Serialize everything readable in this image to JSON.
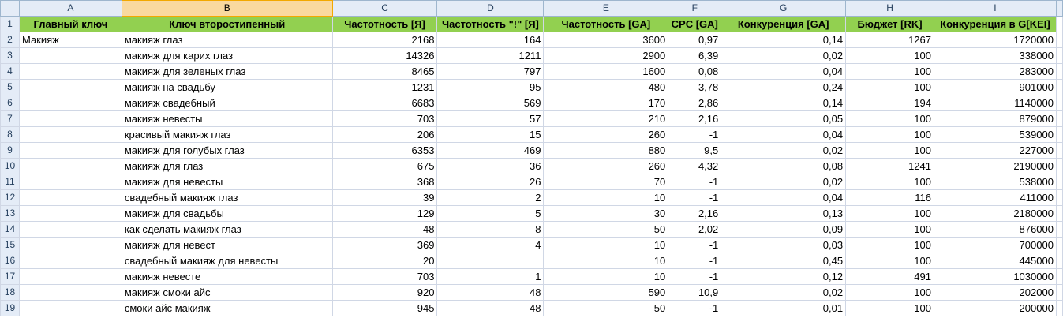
{
  "columns": [
    "A",
    "B",
    "C",
    "D",
    "E",
    "F",
    "G",
    "H",
    "I"
  ],
  "headers": [
    "Главный ключ",
    "Ключ второстипенный",
    "Частотность [Я]",
    "Частотность \"!\" [Я]",
    "Частотность [GA]",
    "CPC [GA]",
    "Конкуренция [GA]",
    "Бюджет [RK]",
    "Конкуренция в G[KEI]"
  ],
  "rows": [
    {
      "n": "2",
      "a": "Макияж",
      "b": "макияж глаз",
      "c": "2168",
      "d": "164",
      "e": "3600",
      "f": "0,97",
      "g": "0,14",
      "h": "1267",
      "i": "1720000"
    },
    {
      "n": "3",
      "a": "",
      "b": "макияж для карих глаз",
      "c": "14326",
      "d": "1211",
      "e": "2900",
      "f": "6,39",
      "g": "0,02",
      "h": "100",
      "i": "338000"
    },
    {
      "n": "4",
      "a": "",
      "b": "макияж для зеленых глаз",
      "c": "8465",
      "d": "797",
      "e": "1600",
      "f": "0,08",
      "g": "0,04",
      "h": "100",
      "i": "283000"
    },
    {
      "n": "5",
      "a": "",
      "b": "макияж на свадьбу",
      "c": "1231",
      "d": "95",
      "e": "480",
      "f": "3,78",
      "g": "0,24",
      "h": "100",
      "i": "901000"
    },
    {
      "n": "6",
      "a": "",
      "b": "макияж свадебный",
      "c": "6683",
      "d": "569",
      "e": "170",
      "f": "2,86",
      "g": "0,14",
      "h": "194",
      "i": "1140000"
    },
    {
      "n": "7",
      "a": "",
      "b": "макияж невесты",
      "c": "703",
      "d": "57",
      "e": "210",
      "f": "2,16",
      "g": "0,05",
      "h": "100",
      "i": "879000"
    },
    {
      "n": "8",
      "a": "",
      "b": "красивый макияж глаз",
      "c": "206",
      "d": "15",
      "e": "260",
      "f": "-1",
      "g": "0,04",
      "h": "100",
      "i": "539000"
    },
    {
      "n": "9",
      "a": "",
      "b": "макияж для голубых глаз",
      "c": "6353",
      "d": "469",
      "e": "880",
      "f": "9,5",
      "g": "0,02",
      "h": "100",
      "i": "227000"
    },
    {
      "n": "10",
      "a": "",
      "b": "макияж для глаз",
      "c": "675",
      "d": "36",
      "e": "260",
      "f": "4,32",
      "g": "0,08",
      "h": "1241",
      "i": "2190000"
    },
    {
      "n": "11",
      "a": "",
      "b": "макияж для невесты",
      "c": "368",
      "d": "26",
      "e": "70",
      "f": "-1",
      "g": "0,02",
      "h": "100",
      "i": "538000"
    },
    {
      "n": "12",
      "a": "",
      "b": "свадебный макияж глаз",
      "c": "39",
      "d": "2",
      "e": "10",
      "f": "-1",
      "g": "0,04",
      "h": "116",
      "i": "411000"
    },
    {
      "n": "13",
      "a": "",
      "b": "макияж для свадьбы",
      "c": "129",
      "d": "5",
      "e": "30",
      "f": "2,16",
      "g": "0,13",
      "h": "100",
      "i": "2180000"
    },
    {
      "n": "14",
      "a": "",
      "b": "как сделать макияж глаз",
      "c": "48",
      "d": "8",
      "e": "50",
      "f": "2,02",
      "g": "0,09",
      "h": "100",
      "i": "876000"
    },
    {
      "n": "15",
      "a": "",
      "b": "макияж для невест",
      "c": "369",
      "d": "4",
      "e": "10",
      "f": "-1",
      "g": "0,03",
      "h": "100",
      "i": "700000"
    },
    {
      "n": "16",
      "a": "",
      "b": "свадебный макияж для невесты",
      "c": "20",
      "d": "",
      "e": "10",
      "f": "-1",
      "g": "0,45",
      "h": "100",
      "i": "445000"
    },
    {
      "n": "17",
      "a": "",
      "b": "макияж невесте",
      "c": "703",
      "d": "1",
      "e": "10",
      "f": "-1",
      "g": "0,12",
      "h": "491",
      "i": "1030000"
    },
    {
      "n": "18",
      "a": "",
      "b": "макияж смоки айс",
      "c": "920",
      "d": "48",
      "e": "590",
      "f": "10,9",
      "g": "0,02",
      "h": "100",
      "i": "202000"
    },
    {
      "n": "19",
      "a": "",
      "b": "смоки айс макияж",
      "c": "945",
      "d": "48",
      "e": "50",
      "f": "-1",
      "g": "0,01",
      "h": "100",
      "i": "200000"
    }
  ],
  "header_row_number": "1",
  "selected_column": "B",
  "colors": {
    "header_fill": "#92d050",
    "grid_line": "#d0d7e5",
    "heading_bg": "#e4ecf7",
    "selected_heading": "#f9d99f"
  }
}
